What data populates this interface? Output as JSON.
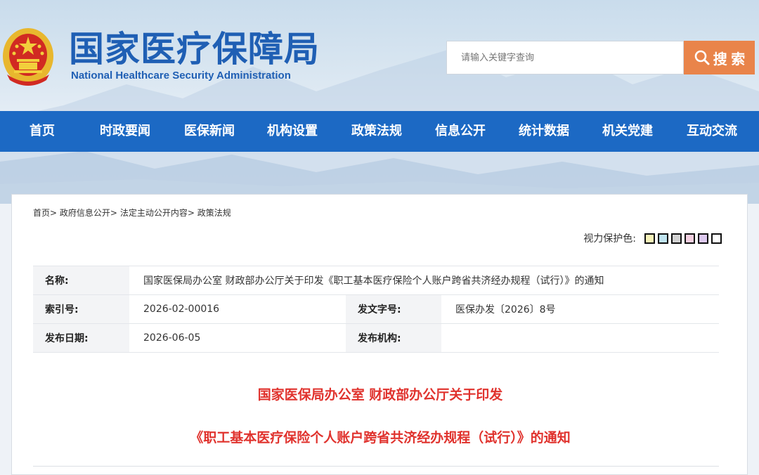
{
  "header": {
    "site_title": "国家医疗保障局",
    "site_title_en": "National Healthcare Security Administration",
    "search_placeholder": "请输入关键字查询",
    "search_button": "搜 索"
  },
  "nav": {
    "items": [
      "首页",
      "时政要闻",
      "医保新闻",
      "机构设置",
      "政策法规",
      "信息公开",
      "统计数据",
      "机关党建",
      "互动交流"
    ]
  },
  "breadcrumb": {
    "items": [
      "首页",
      "政府信息公开",
      "法定主动公开内容",
      "政策法规"
    ],
    "separator": ">"
  },
  "vision": {
    "label": "视力保护色:",
    "swatches": [
      "#f7f2b8",
      "#bfe3ef",
      "#d2d2d2",
      "#f3cfe0",
      "#dcc8ee",
      "#ffffff"
    ]
  },
  "meta": {
    "name_label": "名称:",
    "name_value": "国家医保局办公室 财政部办公厅关于印发《职工基本医疗保险个人账户跨省共济经办规程（试行）》的通知",
    "index_label": "索引号:",
    "index_value": "2026-02-00016",
    "docno_label": "发文字号:",
    "docno_value": "医保办发〔2026〕8号",
    "date_label": "发布日期:",
    "date_value": "2026-06-05",
    "org_label": "发布机构:",
    "org_value": ""
  },
  "document": {
    "title_line1": "国家医保局办公室 财政部办公厅关于印发",
    "title_line2": "《职工基本医疗保险个人账户跨省共济经办规程（试行）》的通知"
  },
  "colors": {
    "brand_blue": "#1c69c4",
    "title_red": "#e0322d",
    "search_orange": "#e9844a"
  }
}
